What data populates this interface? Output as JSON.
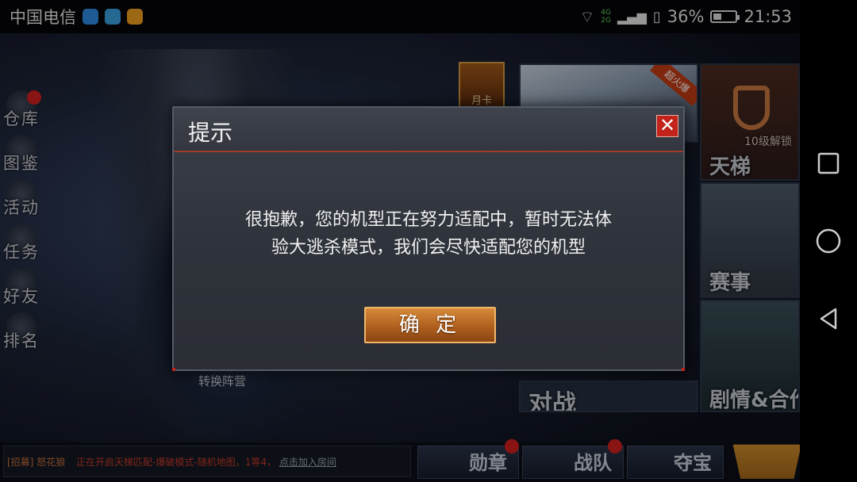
{
  "status_bar": {
    "carrier": "中国电信",
    "network_top": "4G",
    "network_bottom": "2G",
    "battery": "36%",
    "battery_level": 0.36,
    "time": "21:53"
  },
  "side_menu": [
    {
      "label": "仓库"
    },
    {
      "label": "图鉴"
    },
    {
      "label": "活动"
    },
    {
      "label": "任务"
    },
    {
      "label": "好友"
    },
    {
      "label": "排名"
    }
  ],
  "month_card": "月卡",
  "tiles": {
    "top_badge": "超火爆",
    "ladder_lock": "10级解锁",
    "ladder": "天梯",
    "event": "赛事",
    "story": "剧情&合作",
    "battle": "对战"
  },
  "switch_camp": "转换阵营",
  "chat": {
    "tag": "[招募]",
    "sender": "怒花狼",
    "message": "正在开启天梯匹配-爆破模式-随机地图，1等4，",
    "link": "点击加入房间"
  },
  "bottom_buttons": {
    "medal": "勋章",
    "team": "战队",
    "treasure": "夺宝"
  },
  "dialog": {
    "title": "提示",
    "message_line1": "很抱歉，您的机型正在努力适配中，暂时无法体",
    "message_line2": "验大逃杀模式，我们会尽快适配您的机型",
    "confirm": "确 定",
    "close": "✕"
  }
}
